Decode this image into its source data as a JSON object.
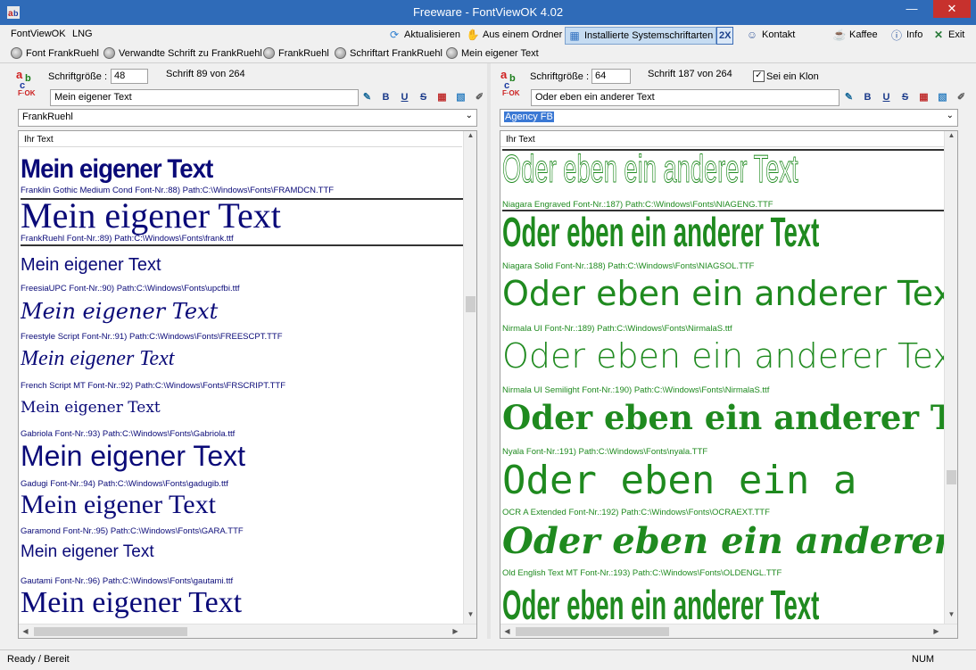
{
  "window": {
    "title": "Freeware - FontViewOK 4.02",
    "minimize_glyph": "—",
    "maximize_glyph": "☐",
    "close_glyph": "✕"
  },
  "menu": {
    "app": "FontViewOK",
    "lng": "LNG"
  },
  "toolbar": {
    "refresh": "Aktualisieren",
    "from_folder": "Aus einem Ordner",
    "installed_fonts": "Installierte Systemschriftarten",
    "twox": "2X",
    "contact": "Kontakt",
    "coffee": "Kaffee",
    "info": "Info",
    "exit": "Exit"
  },
  "favorites": [
    "Font FrankRuehl",
    "Verwandte Schrift zu FrankRuehl",
    "FrankRuehl",
    "Schriftart FrankRuehl",
    "Mein eigener Text"
  ],
  "left": {
    "size_label": "Schriftgröße :",
    "size_value": "48",
    "font_count": "Schrift 89 von 264",
    "sample_text": "Mein eigener Text",
    "font_select": "FrankRuehl",
    "list_header": "Ihr Text",
    "entries": [
      {
        "sample": "Mein eigener Text",
        "caption": "Franklin Gothic Medium Cond Font-Nr.:88) Path:C:\\Windows\\Fonts\\FRAMDCN.TTF"
      },
      {
        "sample": "Mein eigener Text",
        "caption": "FrankRuehl Font-Nr.:89) Path:C:\\Windows\\Fonts\\frank.ttf"
      },
      {
        "sample": "Mein eigener Text",
        "caption": "FreesiaUPC Font-Nr.:90) Path:C:\\Windows\\Fonts\\upcfbi.ttf"
      },
      {
        "sample": "Mein eigener Text",
        "caption": "Freestyle Script Font-Nr.:91) Path:C:\\Windows\\Fonts\\FREESCPT.TTF"
      },
      {
        "sample": "Mein eigener Text",
        "caption": "French Script MT Font-Nr.:92) Path:C:\\Windows\\Fonts\\FRSCRIPT.TTF"
      },
      {
        "sample": "Mein eigener Text",
        "caption": "Gabriola Font-Nr.:93) Path:C:\\Windows\\Fonts\\Gabriola.ttf"
      },
      {
        "sample": "Mein eigener Text",
        "caption": "Gadugi Font-Nr.:94) Path:C:\\Windows\\Fonts\\gadugib.ttf"
      },
      {
        "sample": "Mein eigener Text",
        "caption": "Garamond Font-Nr.:95) Path:C:\\Windows\\Fonts\\GARA.TTF"
      },
      {
        "sample": "Mein eigener Text",
        "caption": "Gautami Font-Nr.:96) Path:C:\\Windows\\Fonts\\gautami.ttf"
      },
      {
        "sample": "Mein eigener Text",
        "caption": ""
      }
    ]
  },
  "right": {
    "size_label": "Schriftgröße :",
    "size_value": "64",
    "font_count": "Schrift 187 von 264",
    "clone_label": "Sei ein Klon",
    "clone_checked": "✓",
    "sample_text": "Oder eben ein anderer Text",
    "font_select": "Agency FB",
    "list_header": "Ihr Text",
    "entries": [
      {
        "sample": "Oder eben ein anderer Text",
        "caption": "Niagara Engraved Font-Nr.:187) Path:C:\\Windows\\Fonts\\NIAGENG.TTF"
      },
      {
        "sample": "Oder eben ein anderer Text",
        "caption": "Niagara Solid Font-Nr.:188) Path:C:\\Windows\\Fonts\\NIAGSOL.TTF"
      },
      {
        "sample": "Oder eben ein anderer Text",
        "caption": "Nirmala UI Font-Nr.:189) Path:C:\\Windows\\Fonts\\NirmalaS.ttf"
      },
      {
        "sample": "Oder eben ein anderer Text",
        "caption": "Nirmala UI Semilight Font-Nr.:190) Path:C:\\Windows\\Fonts\\NirmalaS.ttf"
      },
      {
        "sample": "Oder eben ein anderer Text",
        "caption": "Nyala Font-Nr.:191) Path:C:\\Windows\\Fonts\\nyala.TTF"
      },
      {
        "sample": "Oder eben ein a",
        "caption": "OCR A Extended Font-Nr.:192) Path:C:\\Windows\\Fonts\\OCRAEXT.TTF"
      },
      {
        "sample": "Oder eben ein anderer Tex",
        "caption": "Old English Text MT Font-Nr.:193) Path:C:\\Windows\\Fonts\\OLDENGL.TTF"
      },
      {
        "sample": "Oder eben ein anderer Text",
        "caption": ""
      }
    ]
  },
  "status": {
    "text": "Ready / Bereit",
    "num": "NUM"
  },
  "colors": {
    "left_text": "#0a0a78",
    "right_text": "#1f8a1f",
    "titlebar": "#2f6bb8"
  }
}
